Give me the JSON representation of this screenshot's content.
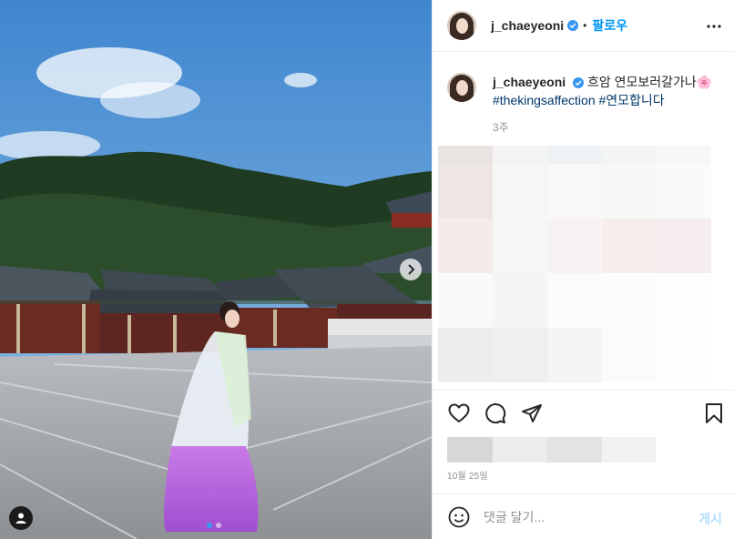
{
  "post": {
    "username": "j_chaeyeoni",
    "follow_label": "팔로우",
    "separator": "•",
    "caption_text": "흐암 연모보러갈가나",
    "caption_emoji": "🌸",
    "hashtags": [
      "#thekingsaffection",
      "#연모합니다"
    ],
    "time_ago": "3주",
    "date": "10월 25일",
    "comment_placeholder": "댓글 달기...",
    "post_label": "게시",
    "carousel_total": 2,
    "carousel_index": 1
  },
  "icons": {
    "verified": "verified-badge-icon",
    "more": "more-options-icon",
    "like": "heart-icon",
    "comment": "comment-icon",
    "share": "share-icon",
    "save": "bookmark-icon",
    "emoji": "smiley-icon",
    "next": "chevron-right-icon",
    "tag": "user-tag-icon"
  },
  "colors": {
    "accent": "#0095f6",
    "verified": "#3897f0",
    "hashtag": "#00376b",
    "muted": "#8e8e8e",
    "post_disabled": "#b2dffc"
  }
}
